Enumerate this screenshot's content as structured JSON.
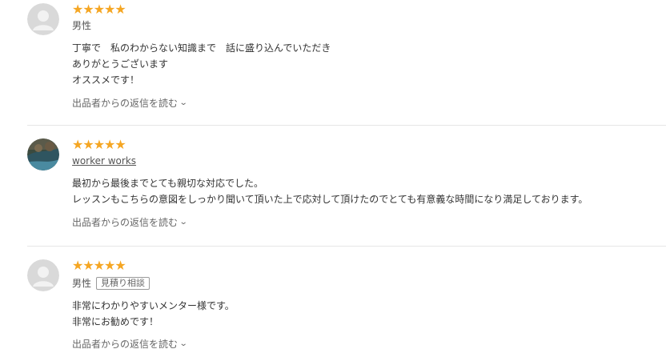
{
  "reviews": [
    {
      "stars": "★★★★★",
      "reviewer": "男性",
      "badge": "",
      "lines": [
        "丁寧で　私のわからない知識まで　話に盛り込んでいただき",
        "ありがとうございます",
        "オススメです！"
      ],
      "reply_label": "出品者からの返信を読む"
    },
    {
      "stars": "★★★★★",
      "reviewer": "worker works",
      "badge": "",
      "lines": [
        "最初から最後までとても親切な対応でした。",
        "レッスンもこちらの意図をしっかり聞いて頂いた上で応対して頂けたのでとても有意義な時間になり満足しております。"
      ],
      "reply_label": "出品者からの返信を読む"
    },
    {
      "stars": "★★★★★",
      "reviewer": "男性",
      "badge": "見積り相談",
      "lines": [
        "非常にわかりやすいメンター様です。",
        "非常にお勧めです！"
      ],
      "reply_label": "出品者からの返信を読む"
    }
  ],
  "colors": {
    "star": "#f5a623",
    "divider": "#e6e6e6",
    "text": "#333333",
    "subtext": "#555555"
  },
  "icons": {
    "avatar_default": "default-avatar-icon",
    "avatar_photo": "user-photo-avatar",
    "chevron": "chevron-down-icon"
  }
}
